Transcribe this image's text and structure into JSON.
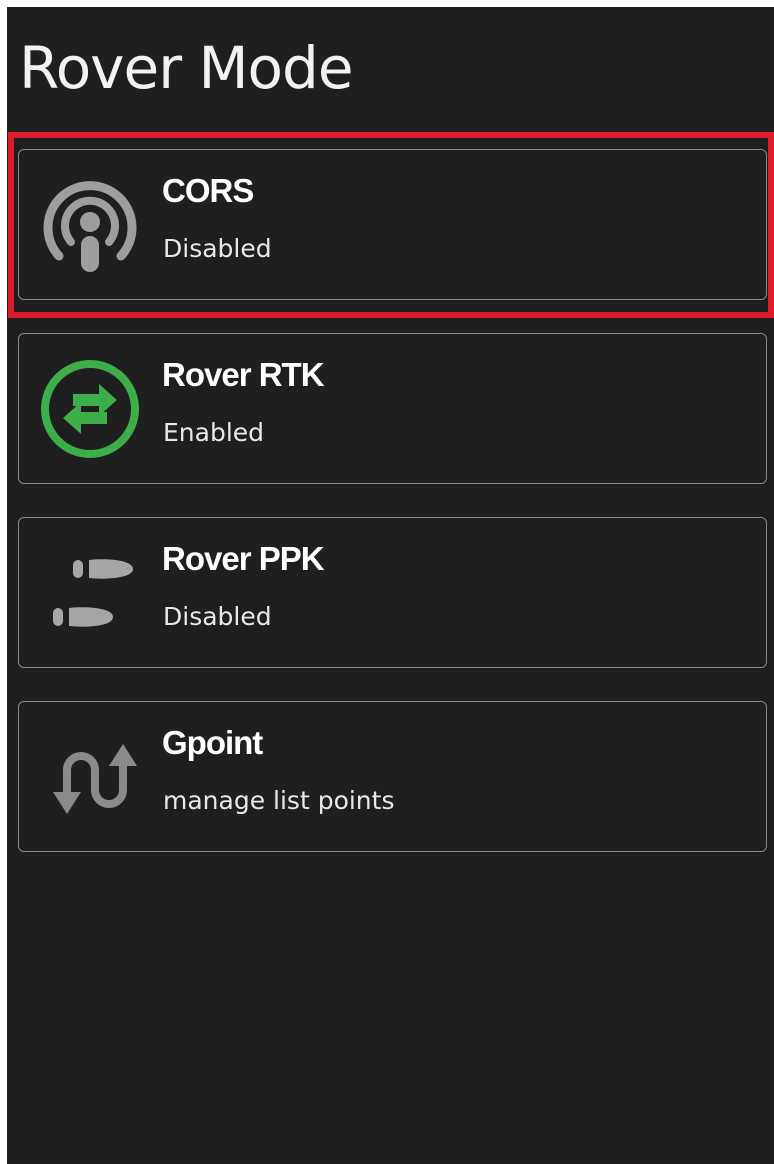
{
  "page": {
    "title": "Rover Mode"
  },
  "modes": [
    {
      "id": "cors",
      "label": "CORS",
      "status": "Disabled",
      "icon": "podcast-icon",
      "icon_color": "#9e9e9e",
      "selected": true
    },
    {
      "id": "rover-rtk",
      "label": "Rover RTK",
      "status": "Enabled",
      "icon": "swap-arrows-icon",
      "icon_color": "#3dae49",
      "selected": false
    },
    {
      "id": "rover-ppk",
      "label": "Rover PPK",
      "status": "Disabled",
      "icon": "shoe-prints-icon",
      "icon_color": "#a6a6a6",
      "selected": false
    },
    {
      "id": "gpoint",
      "label": "Gpoint",
      "status": "manage list points",
      "icon": "route-arrows-icon",
      "icon_color": "#8a8a8a",
      "selected": false
    }
  ],
  "colors": {
    "background": "#1f1f1f",
    "highlight": "#e01b2b",
    "card_border": "#8a8a8a",
    "text": "#ffffff"
  }
}
